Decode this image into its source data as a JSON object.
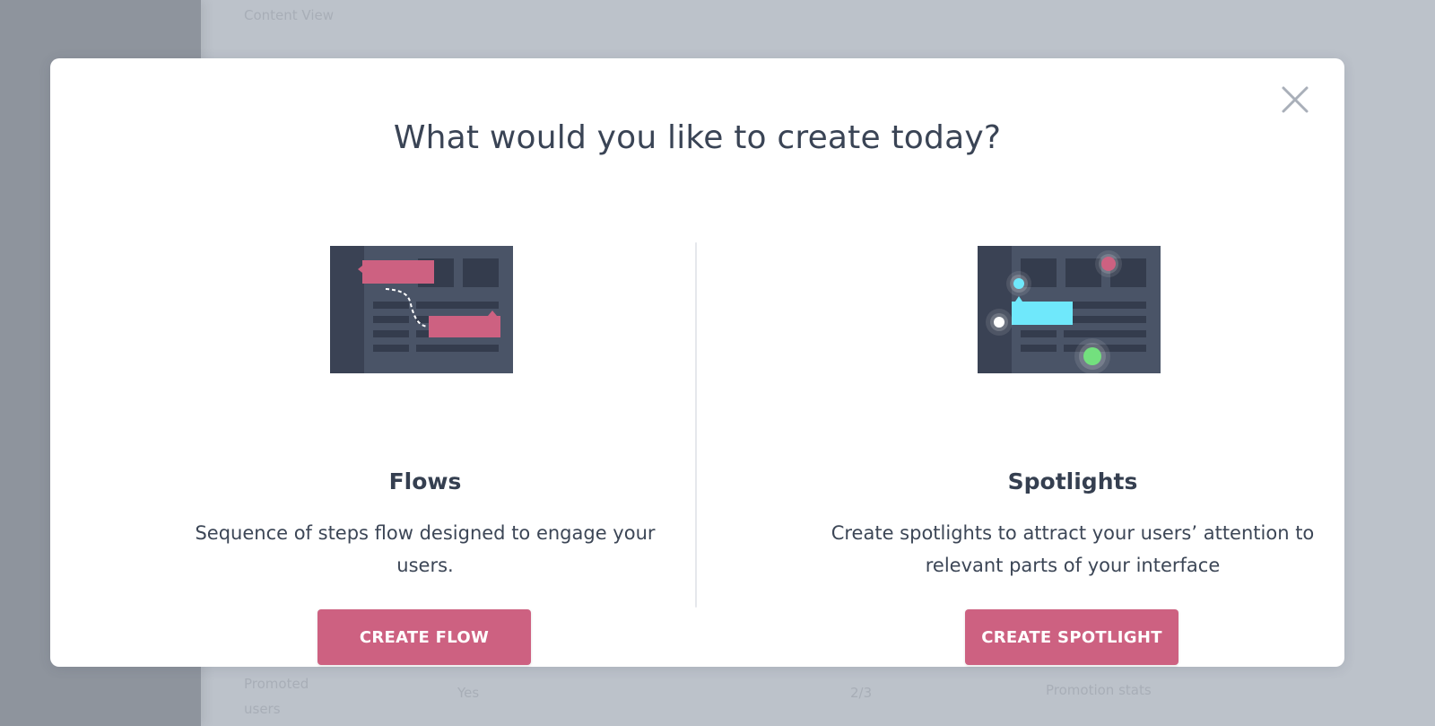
{
  "background": {
    "faint_texts": [
      "Content View",
      "Promoted users",
      "Yes",
      "2/3",
      "Promotion stats"
    ]
  },
  "modal": {
    "title": "What would you like to create today?",
    "close_icon": "close-icon",
    "options": [
      {
        "title": "Flows",
        "description": "Sequence of steps flow designed to engage your users.",
        "button_label": "CREATE FLOW",
        "illustration_icon": "flows-illustration"
      },
      {
        "title": "Spotlights",
        "description": "Create spotlights to attract your users’ attention to relevant parts of your interface",
        "button_label": "CREATE SPOTLIGHT",
        "illustration_icon": "spotlights-illustration"
      }
    ]
  },
  "colors": {
    "accent": "#cd6181",
    "text_dark": "#3a4455",
    "backdrop": "#bcc2ca",
    "illustration_bg": "#4a5467",
    "spotlight_cyan": "#6fe8fb",
    "spotlight_green": "#73e07e"
  }
}
